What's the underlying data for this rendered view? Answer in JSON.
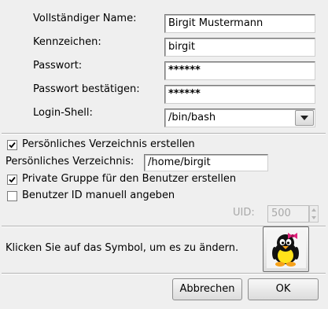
{
  "form": {
    "fullname_label": "Vollständiger Name:",
    "fullname_value": "Birgit Mustermann",
    "login_label": "Kennzeichen:",
    "login_value": "birgit",
    "password_label": "Passwort:",
    "password_value": "******",
    "password_confirm_label": "Passwort bestätigen:",
    "password_confirm_value": "******",
    "shell_label": "Login-Shell:",
    "shell_value": "/bin/bash"
  },
  "options": {
    "create_home_label": "Persönliches Verzeichnis erstellen",
    "create_home_checked": true,
    "home_dir_label": "Persönliches Verzeichnis:",
    "home_dir_value": "/home/birgit",
    "private_group_label": "Private Gruppe für den Benutzer erstellen",
    "private_group_checked": true,
    "manual_uid_label": "Benutzer ID manuell angeben",
    "manual_uid_checked": false,
    "uid_label": "UID:",
    "uid_value": "500"
  },
  "icon_section": {
    "hint": "Klicken Sie auf das Symbol, um es zu ändern.",
    "icon": "penguin-girl-avatar-icon"
  },
  "buttons": {
    "cancel": "Abbrechen",
    "ok": "OK"
  }
}
